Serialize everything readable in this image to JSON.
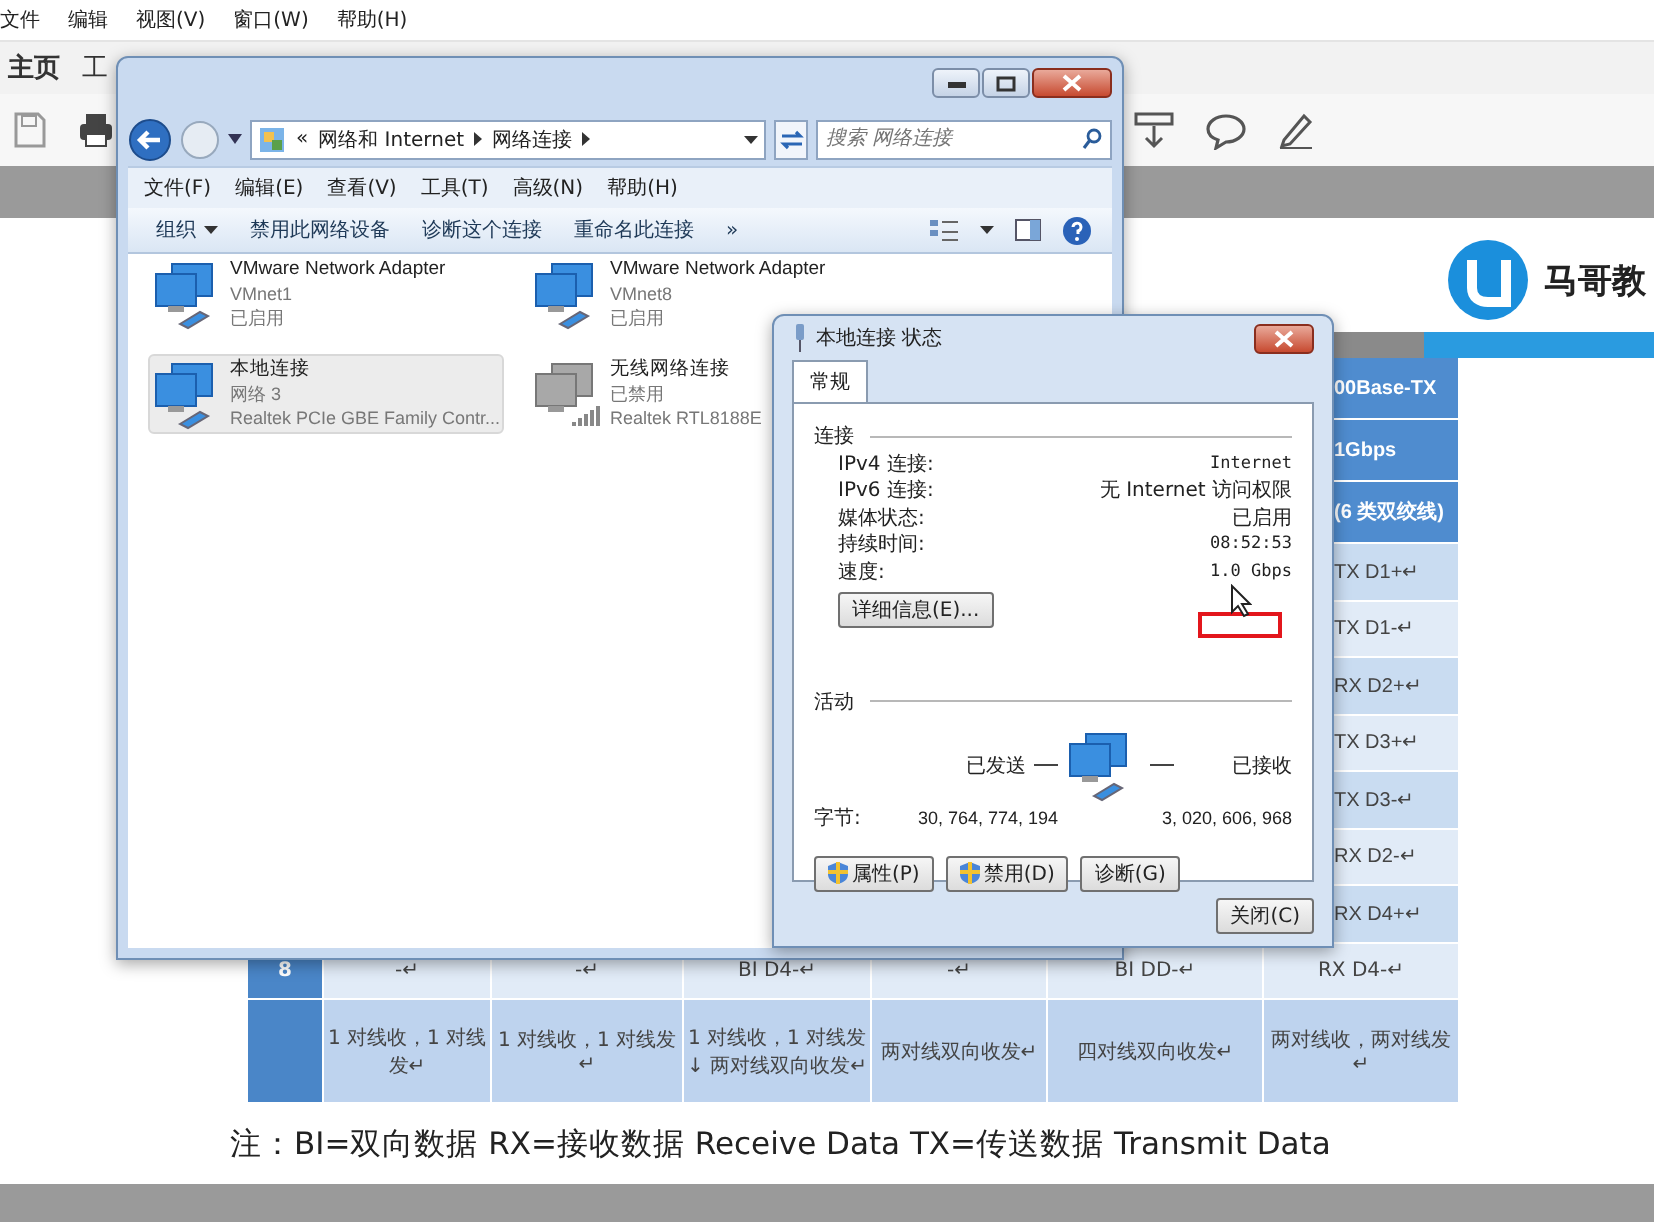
{
  "app": {
    "menu": [
      "文件",
      "编辑",
      "视图(V)",
      "窗口(W)",
      "帮助(H)"
    ],
    "tabs": [
      {
        "label": "主页",
        "selected": true
      },
      {
        "label": "工",
        "selected": false
      }
    ]
  },
  "document": {
    "logo": {
      "name": "马哥教"
    },
    "table": {
      "right_column": [
        {
          "kind": "header",
          "text": "00Base-TX"
        },
        {
          "kind": "header",
          "text": "1Gbps"
        },
        {
          "kind": "header",
          "text": "(6 类双绞线)"
        },
        {
          "kind": "body",
          "text": "TX D1+↵"
        },
        {
          "kind": "body",
          "text": "TX D1-↵"
        },
        {
          "kind": "body",
          "text": "RX D2+↵"
        },
        {
          "kind": "body",
          "text": "TX D3+↵"
        },
        {
          "kind": "body",
          "text": "TX D3-↵"
        },
        {
          "kind": "body",
          "text": "RX D2-↵"
        },
        {
          "kind": "body",
          "text": "RX D4+↵"
        }
      ],
      "rows": [
        {
          "head": "8",
          "cells": [
            "-↵",
            "-↵",
            "BI D4-↵",
            "-↵",
            "BI DD-↵",
            "RX D4-↵"
          ]
        },
        {
          "cells": [
            "1 对线收，1 对线发↵",
            "1 对线收，1 对线发↵",
            "1 对线收，1 对线发↓ 两对线双向收发↵",
            "两对线双向收发↵",
            "四对线双向收发↵",
            "两对线收，两对线发↵"
          ]
        }
      ]
    },
    "note": "注：BI=双向数据 RX=接收数据 Receive Data TX=传送数据 Transmit Data"
  },
  "explorer": {
    "breadcrumb": {
      "overflow": "«",
      "items": [
        "网络和 Internet",
        "网络连接"
      ]
    },
    "search": {
      "placeholder": "搜索 网络连接"
    },
    "menu": [
      "文件(F)",
      "编辑(E)",
      "查看(V)",
      "工具(T)",
      "高级(N)",
      "帮助(H)"
    ],
    "commands": [
      {
        "label": "组织",
        "kind": "menu"
      },
      {
        "label": "禁用此网络设备",
        "kind": "plain"
      },
      {
        "label": "诊断这个连接",
        "kind": "plain"
      },
      {
        "label": "重命名此连接",
        "kind": "plain"
      },
      {
        "label": "»",
        "kind": "plain"
      }
    ],
    "adapters": [
      {
        "name": "VMware Network Adapter",
        "line2": "VMnet1",
        "line3": "已启用",
        "kind": "wired",
        "enabled": true,
        "selected": false
      },
      {
        "name": "VMware Network Adapter",
        "line2": "VMnet8",
        "line3": "已启用",
        "kind": "wired",
        "enabled": true,
        "selected": false
      },
      {
        "name": "本地连接",
        "line2": "网络  3",
        "line3": "Realtek PCIe GBE Family Contr...",
        "kind": "wired",
        "enabled": true,
        "selected": true
      },
      {
        "name": "无线网络连接",
        "line2": "已禁用",
        "line3": "Realtek RTL8188E",
        "kind": "wireless",
        "enabled": false,
        "selected": false
      }
    ]
  },
  "status_dialog": {
    "title": "本地连接 状态",
    "tab": {
      "label": "常规",
      "selected": true
    },
    "connection": {
      "heading": "连接",
      "rows": [
        {
          "label": "IPv4 连接:",
          "value": "Internet"
        },
        {
          "label": "IPv6 连接:",
          "value": "无 Internet 访问权限"
        },
        {
          "label": "媒体状态:",
          "value": "已启用"
        },
        {
          "label": "持续时间:",
          "value": "08:52:53"
        },
        {
          "label": "速度:",
          "value": "1.0 Gbps"
        }
      ],
      "details_button": "详细信息(E)..."
    },
    "activity": {
      "heading": "活动",
      "sent_label": "已发送",
      "received_label": "已接收",
      "bytes_label": "字节:",
      "sent": "30, 764, 774, 194",
      "received": "3, 020, 606, 968"
    },
    "buttons": [
      {
        "label": "属性(P)",
        "shield": true
      },
      {
        "label": "禁用(D)",
        "shield": true
      },
      {
        "label": "诊断(G)",
        "shield": false
      }
    ],
    "close_button": "关闭(C)"
  }
}
